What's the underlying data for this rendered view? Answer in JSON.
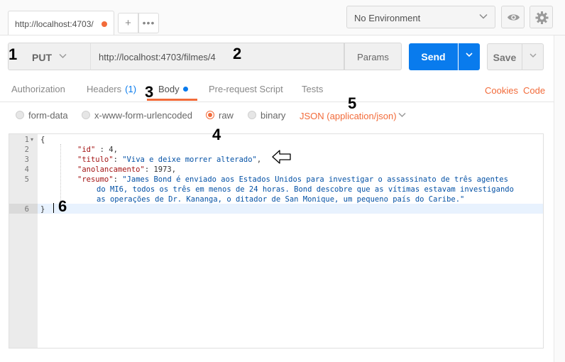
{
  "tabbar": {
    "active_tab_label": "http://localhost:4703/",
    "add_tab_glyph": "+",
    "more_glyph": "•••",
    "environment_label": "No Environment",
    "environment_chevron": "⌄",
    "eye_icon": "eye-icon",
    "gear_icon": "gear-icon",
    "unsaved_dot_color": "#f26b3a"
  },
  "request": {
    "method": "PUT",
    "method_chevron": "⌄",
    "url": "http://localhost:4703/filmes/4",
    "params_label": "Params",
    "send_label": "Send",
    "send_dropdown_glyph": "⌄",
    "save_label": "Save",
    "save_dropdown_glyph": "⌄",
    "accent_color": "#097bed"
  },
  "request_tabs": {
    "authorization": "Authorization",
    "headers": "Headers",
    "headers_count": "(1)",
    "body": "Body",
    "prerequest": "Pre-request Script",
    "tests": "Tests",
    "cookies": "Cookies",
    "code": "Code"
  },
  "body_modes": {
    "form_data": "form-data",
    "urlencoded": "x-www-form-urlencoded",
    "raw": "raw",
    "binary": "binary",
    "selected": "raw",
    "content_type": "JSON (application/json)",
    "content_type_chevron": "⌄"
  },
  "editor": {
    "line_numbers": [
      "1",
      "2",
      "3",
      "4",
      "5",
      "6"
    ],
    "fold_glyph": "▾",
    "line1": "{",
    "line2_key": "\"id\"",
    "line2_rest": " : 4,",
    "line3_key": "\"titulo\"",
    "line3_sep": ": ",
    "line3_val": "\"Viva e deixe morrer alterado\"",
    "line3_end": ",",
    "line4_key": "\"anolancamento\"",
    "line4_rest": ": 1973,",
    "line5_key": "\"resumo\"",
    "line5_sep": ": ",
    "line5_val_a": "\"James Bond é enviado aos Estados Unidos para investigar o assassinato de três agentes",
    "line5_val_b": "do MI6, todos os três em menos de 24 horas. Bond descobre que as vítimas estavam investigando",
    "line5_val_c": "as operações de Dr. Kananga, o ditador de San Monique, um pequeno país do Caribe.\"",
    "line6": "}",
    "active_line": 6
  },
  "annotations": {
    "n1": "1",
    "n2": "2",
    "n3": "3",
    "n4": "4",
    "n5": "5",
    "n6": "6",
    "arrow": "left-arrow-outline"
  }
}
